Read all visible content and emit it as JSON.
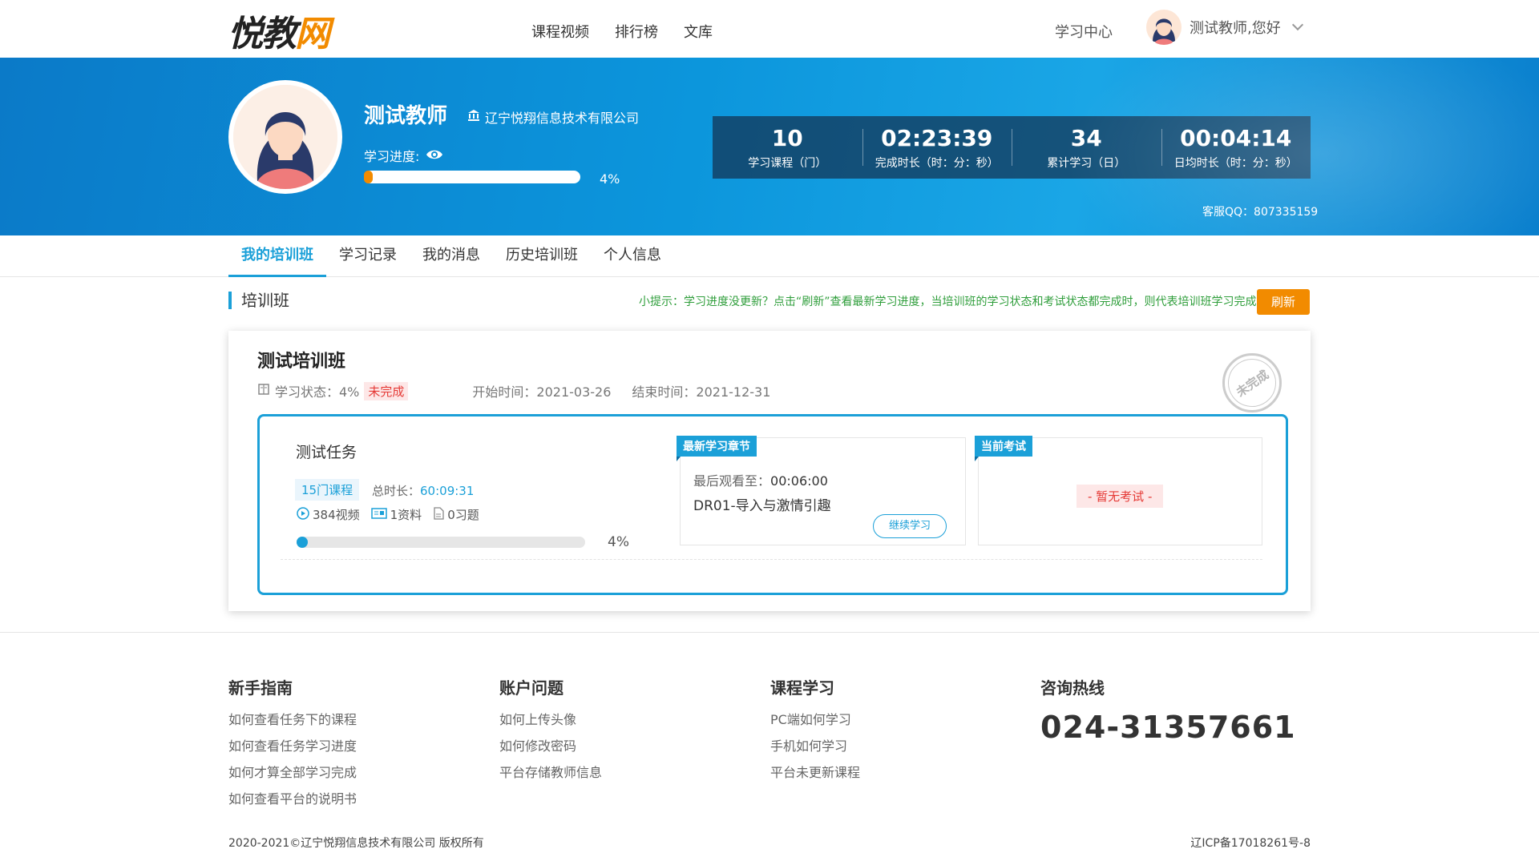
{
  "header": {
    "logo_main": "悦教",
    "logo_accent": "网",
    "nav": [
      "课程视频",
      "排行榜",
      "文库"
    ],
    "study_center": "学习中心",
    "greeting": "测试教师,您好"
  },
  "profile": {
    "name": "测试教师",
    "org": "辽宁悦翔信息技术有限公司",
    "progress_label": "学习进度:",
    "progress_value": 0.04,
    "progress_text": "4%",
    "stats": [
      {
        "value": "10",
        "label": "学习课程（门）"
      },
      {
        "value": "02:23:39",
        "label": "完成时长（时：分：秒）"
      },
      {
        "value": "34",
        "label": "累计学习（日）"
      },
      {
        "value": "00:04:14",
        "label": "日均时长（时：分：秒）"
      }
    ],
    "qq": "客服QQ：807335159"
  },
  "tabs": [
    "我的培训班",
    "学习记录",
    "我的消息",
    "历史培训班",
    "个人信息"
  ],
  "section": {
    "title": "培训班",
    "tip": "小提示：学习进度没更新？点击“刷新”查看最新学习进度，当培训班的学习状态和考试状态都完成时，则代表培训班学习完成。",
    "refresh": "刷新"
  },
  "class": {
    "title": "测试培训班",
    "status_label": "学习状态：4%",
    "status_badge": "未完成",
    "start": "开始时间：2021-03-26",
    "end": "结束时间：2021-12-31",
    "stamp": "未完成",
    "task": {
      "name": "测试任务",
      "course_count": "15门课程",
      "duration_label": "总时长：",
      "duration_value": "60:09:31",
      "videos": "384视频",
      "materials": "1资料",
      "exercises": "0习题",
      "progress_value": 0.04,
      "progress_text": "4%"
    },
    "latest": {
      "tag": "最新学习章节",
      "last_watch_label": "最后观看至：",
      "last_watch_time": "00:06:00",
      "chapter": "DR01-导入与激情引趣",
      "continue": "继续学习"
    },
    "exam": {
      "tag": "当前考试",
      "empty": "- 暂无考试 -"
    }
  },
  "footer": {
    "columns": [
      {
        "title": "新手指南",
        "links": [
          "如何查看任务下的课程",
          "如何查看任务学习进度",
          "如何才算全部学习完成",
          "如何查看平台的说明书"
        ]
      },
      {
        "title": "账户问题",
        "links": [
          "如何上传头像",
          "如何修改密码",
          "平台存储教师信息"
        ]
      },
      {
        "title": "课程学习",
        "links": [
          "PC端如何学习",
          "手机如何学习",
          "平台未更新课程"
        ]
      }
    ],
    "hotline_title": "咨询热线",
    "hotline": "024-31357661",
    "copyright": "2020-2021©辽宁悦翔信息技术有限公司 版权所有",
    "icp": "辽ICP备17018261号-8"
  },
  "colors": {
    "brand": "#1ba0d8",
    "accent": "#f28b00",
    "danger": "#e53935",
    "tip": "#2f9e3b"
  }
}
